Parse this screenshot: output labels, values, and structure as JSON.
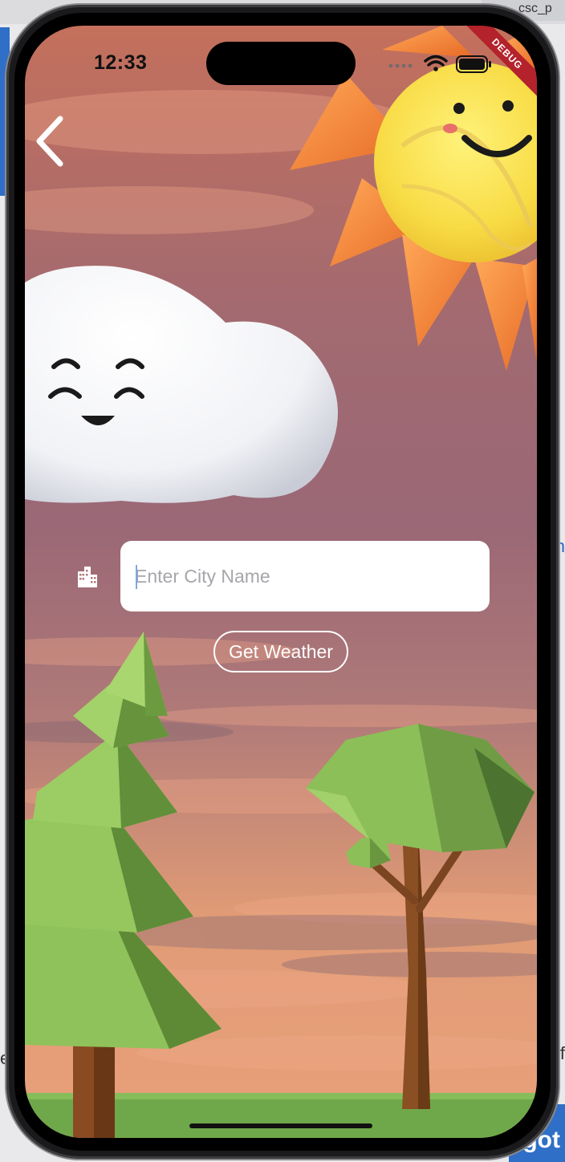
{
  "desktop": {
    "tab_text": "csc_p",
    "right_text_1": "n",
    "right_text_2": "f",
    "left_text": "e",
    "button_text": "got"
  },
  "status_bar": {
    "time": "12:33",
    "debug_label": "DEBUG"
  },
  "back_button": {
    "icon": "chevron-left-icon"
  },
  "city_search": {
    "icon": "city-buildings-icon",
    "value": "",
    "placeholder": "Enter City Name"
  },
  "actions": {
    "get_weather_label": "Get Weather"
  },
  "colors": {
    "sky_top": "#c97a62",
    "sky_mid": "#9c6a78",
    "sky_bottom": "#e69a6c",
    "debug_banner": "#b4222c",
    "grass": "#6fa84a"
  }
}
